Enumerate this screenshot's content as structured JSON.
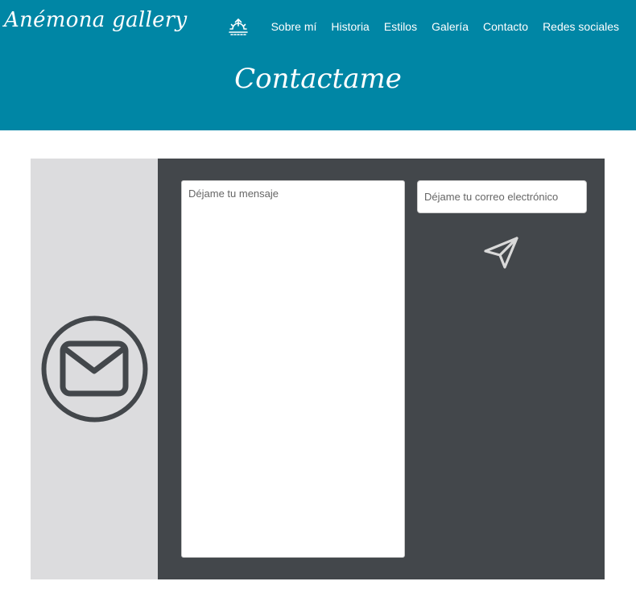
{
  "header": {
    "brand": "Anémona gallery",
    "nav": {
      "home_icon": "sunrise-icon",
      "links": [
        "Sobre mí",
        "Historia",
        "Estilos",
        "Galería",
        "Contacto",
        "Redes sociales"
      ]
    },
    "title": "Contactame"
  },
  "contact": {
    "aside_icon": "mail-circle-icon",
    "message_placeholder": "Déjame tu mensaje",
    "email_placeholder": "Déjame tu correo electrónico",
    "send_icon": "send-icon"
  },
  "colors": {
    "header_bg": "#0086a5",
    "aside_bg": "#dcdcde",
    "panel_bg": "#43474b",
    "icon_dark": "#43474b",
    "icon_light": "#d9d9d9"
  }
}
